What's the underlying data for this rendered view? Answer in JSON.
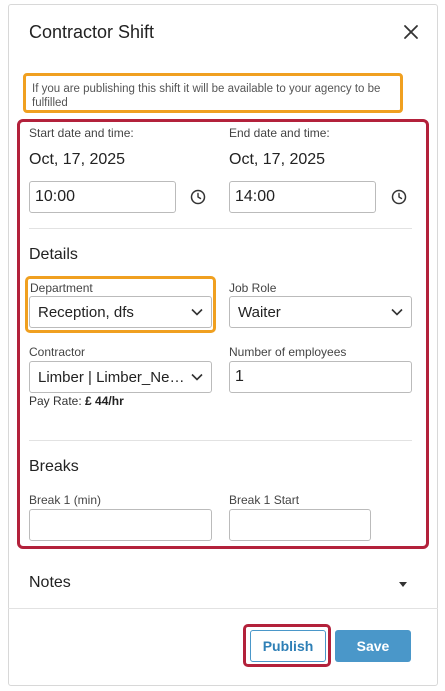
{
  "dialog": {
    "title": "Contractor Shift",
    "close_icon": "close-icon"
  },
  "notice": "If you are publishing this shift it will be available to your agency to be fulfilled",
  "start": {
    "label": "Start date and time:",
    "date": "Oct, 17, 2025",
    "time": "10:00",
    "icon": "clock-icon"
  },
  "end": {
    "label": "End date and time:",
    "date": "Oct, 17, 2025",
    "time": "14:00",
    "icon": "clock-icon"
  },
  "details": {
    "heading": "Details",
    "department": {
      "label": "Department",
      "value": "Reception, dfs"
    },
    "job_role": {
      "label": "Job Role",
      "value": "Waiter"
    },
    "contractor": {
      "label": "Contractor",
      "value": "Limber | Limber_Ne…"
    },
    "employees": {
      "label": "Number of employees",
      "value": "1"
    },
    "pay_rate": {
      "label": "Pay Rate:",
      "value": "£ 44/hr"
    }
  },
  "breaks": {
    "heading": "Breaks",
    "break1_min": {
      "label": "Break 1 (min)",
      "value": ""
    },
    "break1_start": {
      "label": "Break 1 Start",
      "value": ""
    }
  },
  "notes": {
    "label": "Notes"
  },
  "footer": {
    "publish_label": "Publish",
    "save_label": "Save"
  },
  "colors": {
    "accent": "#4a97c9",
    "highlight_orange": "#f0a020",
    "highlight_red": "#b3213b"
  }
}
